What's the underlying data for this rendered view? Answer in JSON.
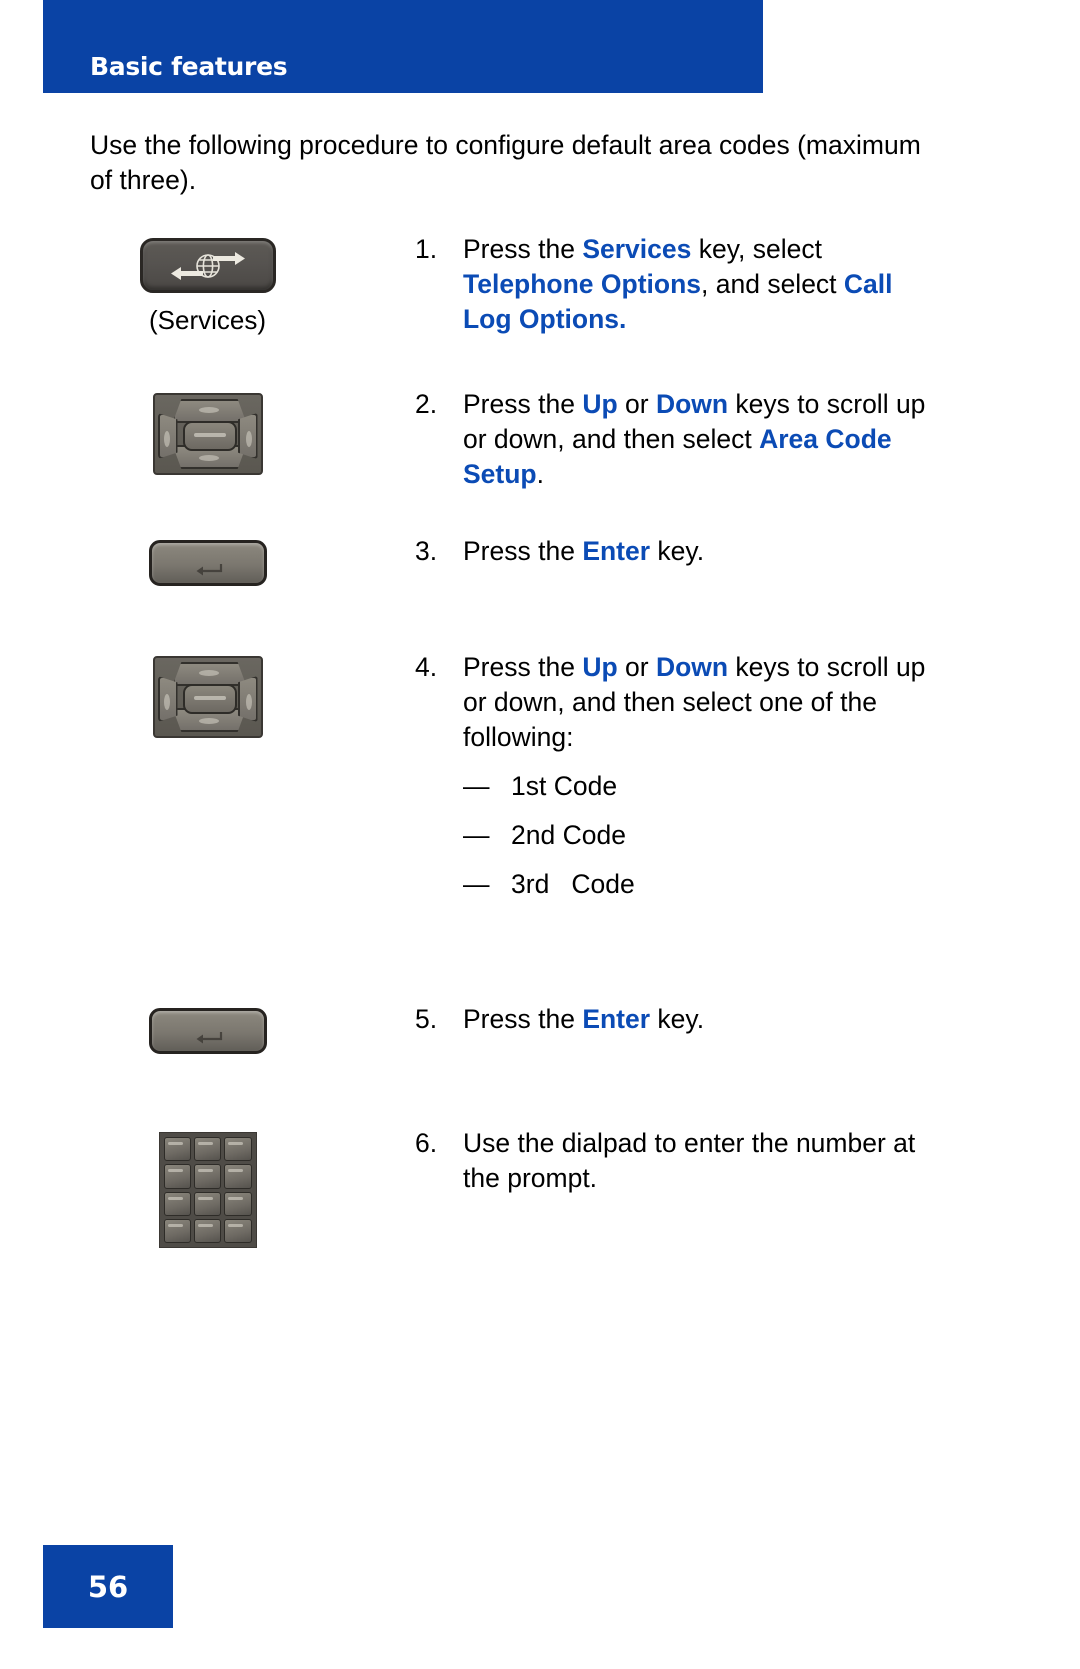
{
  "header": {
    "title": "Basic features"
  },
  "intro": {
    "text": "Use the following procedure to configure default area codes (maximum of three)."
  },
  "steps": [
    {
      "number": "1.",
      "icon": "services-globe-key-icon",
      "caption": "(Services)",
      "segments": [
        {
          "text": "Press the ",
          "bold": false
        },
        {
          "text": "Services",
          "bold": true
        },
        {
          "text": " key, select ",
          "bold": false
        },
        {
          "text": "Telephone Options",
          "bold": true
        },
        {
          "text": ", and select ",
          "bold": false
        },
        {
          "text": "Call Log Options.",
          "bold": true
        }
      ]
    },
    {
      "number": "2.",
      "icon": "navigation-cluster-key-icon",
      "caption": "",
      "segments": [
        {
          "text": "Press the ",
          "bold": false
        },
        {
          "text": "Up",
          "bold": true
        },
        {
          "text": " or ",
          "bold": false
        },
        {
          "text": "Down",
          "bold": true
        },
        {
          "text": " keys to scroll up or down, and then select ",
          "bold": false
        },
        {
          "text": "Area Code Setup",
          "bold": true
        },
        {
          "text": ".",
          "bold": false
        }
      ]
    },
    {
      "number": "3.",
      "icon": "enter-key-icon",
      "caption": "",
      "segments": [
        {
          "text": "Press the ",
          "bold": false
        },
        {
          "text": "Enter",
          "bold": true
        },
        {
          "text": " key.",
          "bold": false
        }
      ]
    },
    {
      "number": "4.",
      "icon": "navigation-cluster-key-icon",
      "caption": "",
      "segments": [
        {
          "text": "Press the ",
          "bold": false
        },
        {
          "text": "Up",
          "bold": true
        },
        {
          "text": " or ",
          "bold": false
        },
        {
          "text": "Down",
          "bold": true
        },
        {
          "text": " keys to scroll up or down, and then select one of the following:",
          "bold": false
        }
      ],
      "sublist": [
        {
          "dash": "—",
          "label": "1st Code"
        },
        {
          "dash": "—",
          "label": "2nd Code"
        },
        {
          "dash": "—",
          "label": "3rd   Code"
        }
      ]
    },
    {
      "number": "5.",
      "icon": "enter-key-icon",
      "caption": "",
      "segments": [
        {
          "text": "Press the ",
          "bold": false
        },
        {
          "text": "Enter",
          "bold": true
        },
        {
          "text": " key.",
          "bold": false
        }
      ]
    },
    {
      "number": "6.",
      "icon": "dialpad-keys-icon",
      "caption": "",
      "segments": [
        {
          "text": "Use the dialpad to enter the number at the prompt.",
          "bold": false
        }
      ]
    }
  ],
  "footer": {
    "page_number": "56"
  },
  "colors": {
    "brand_blue": "#0a43a5",
    "link_blue": "#0b4bb5",
    "body_text": "#000000",
    "key_dark": "#565350"
  }
}
